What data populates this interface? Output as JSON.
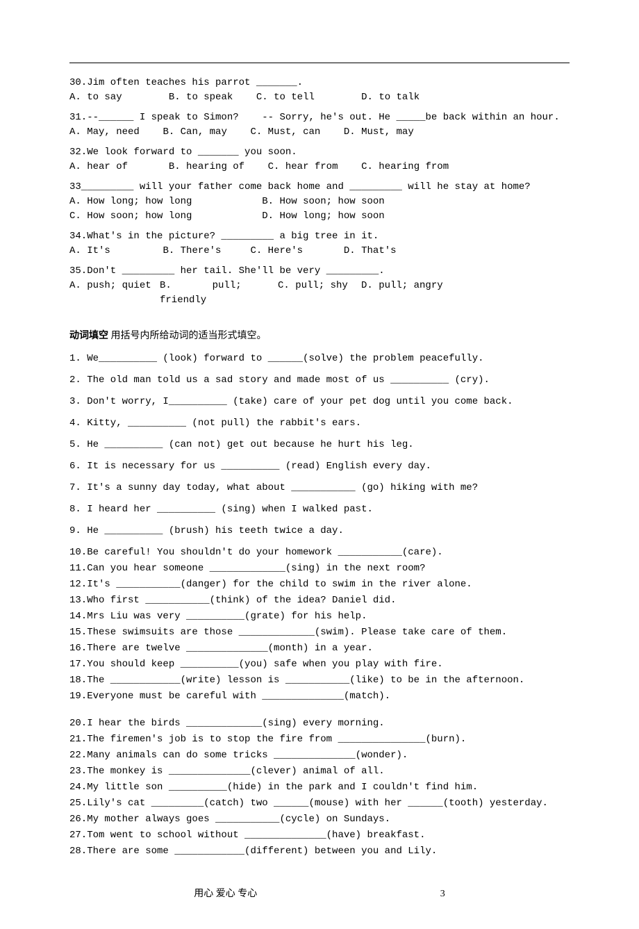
{
  "mc": {
    "q30": {
      "stem": "30.Jim often teaches his parrot _______.",
      "a": "A. to say",
      "b": "B. to speak",
      "c": "C. to tell",
      "d": "D. to talk"
    },
    "q31": {
      "stem": "31.--______ I speak to Simon?    -- Sorry, he's out. He _____be back within an hour.",
      "a": "A. May, need",
      "b": "B. Can, may",
      "c": "C. Must, can",
      "d": "D. Must, may"
    },
    "q32": {
      "stem": "32.We look forward to _______ you soon.",
      "a": "A. hear of",
      "b": "B. hearing of",
      "c": "C. hear from",
      "d": "C. hearing from"
    },
    "q33": {
      "stem": "33_________ will your father come back home and _________ will he stay at home?",
      "a": "A. How long; how long",
      "b": "B. How soon; how soon",
      "c": "C. How soon; how long",
      "d": "D. How long; how soon"
    },
    "q34": {
      "stem": "34.What's in the picture? _________ a big tree in it.",
      "a": "A. It's",
      "b": "B. There's",
      "c": "C. Here's",
      "d": "D. That's"
    },
    "q35": {
      "stem": "35.Don't _________ her tail. She'll be very _________.",
      "a": "A. push; quiet",
      "b": "B.       pull; friendly",
      "c": "C. pull; shy",
      "d": "D. pull; angry"
    }
  },
  "section_title_bold": "动词填空",
  "section_title_rest": " 用括号内所给动词的适当形式填空。",
  "fill": {
    "i1": "1. We__________ (look) forward to ______(solve) the problem peacefully.",
    "i2": "2. The old man told us a sad story and made most of us __________ (cry).",
    "i3": "3. Don't worry, I__________ (take) care of your pet dog until you come back.",
    "i4": "4. Kitty, __________ (not pull) the rabbit's ears.",
    "i5": "5. He __________ (can not) get out because he hurt his leg.",
    "i6": "6. It is necessary for us __________ (read) English every day.",
    "i7": "7. It's a sunny day today, what about ___________ (go) hiking with me?",
    "i8": "8. I heard her __________ (sing) when I walked past.",
    "i9": "9. He __________ (brush) his teeth twice a day.",
    "i10": "10.Be careful! You shouldn't do your homework ___________(care).",
    "i11": "11.Can you hear someone _____________(sing) in the next room?",
    "i12": "12.It's ___________(danger) for the child to swim in the river alone.",
    "i13": "13.Who first ___________(think) of the idea? Daniel did.",
    "i14": "14.Mrs Liu was very __________(grate) for his help.",
    "i15": "15.These swimsuits are those _____________(swim). Please take care of them.",
    "i16": "16.There are twelve ______________(month) in a year.",
    "i17": "17.You should keep __________(you) safe when you play with fire.",
    "i18": "18.The ____________(write) lesson is ___________(like) to be in the afternoon.",
    "i19": "19.Everyone must be careful with ______________(match).",
    "i20": "20.I hear the birds _____________(sing) every morning.",
    "i21": "21.The firemen's job is to stop the fire from _______________(burn).",
    "i22": "22.Many animals can do some tricks ______________(wonder).",
    "i23": "23.The monkey is ______________(clever) animal of all.",
    "i24": "24.My little son __________(hide) in the park and I couldn't find him.",
    "i25": "25.Lily's cat _________(catch) two ______(mouse) with her ______(tooth) yesterday.",
    "i26": "26.My mother always goes ___________(cycle) on Sundays.",
    "i27": "27.Tom went to school without ______________(have) breakfast.",
    "i28": "28.There are some ____________(different) between you and Lily."
  },
  "footer_text": "用心  爱心  专心",
  "page_number": "3"
}
